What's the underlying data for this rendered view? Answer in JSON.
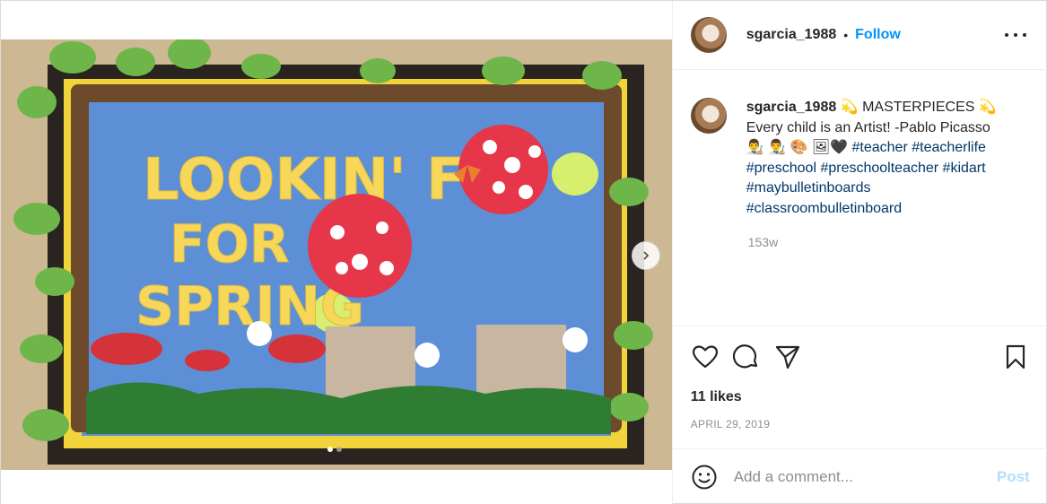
{
  "post": {
    "username": "sgarcia_1988",
    "separator": "•",
    "follow_label": "Follow",
    "caption": {
      "username": "sgarcia_1988",
      "text_line1": " 💫 MASTERPIECES 💫",
      "text_line2": "Every child is an Artist! -Pablo Picasso",
      "emoji_line": "👨‍🎨 👨‍🎨 🎨 🖼🖤 ",
      "hashtags": [
        "#teacher",
        "#teacherlife",
        "#preschool",
        "#preschoolteacher",
        "#kidart",
        "#maybulletinboards",
        "#classroombulletinboard"
      ],
      "time_ago": "153w"
    },
    "likes": "11 likes",
    "date": "APRIL 29, 2019",
    "comment": {
      "placeholder": "Add a comment...",
      "post_label": "Post"
    },
    "image": {
      "board_title_line1": "LOOKIN' FLY",
      "board_title_line2": "FOR",
      "board_title_line3": "SPRING"
    },
    "carousel": {
      "total": 2,
      "current": 1
    },
    "colors": {
      "accent": "#0095f6",
      "link": "#00376b",
      "muted": "#8e8e8e",
      "post_disabled": "#b2dffc"
    },
    "icons": [
      "more-options-icon",
      "heart-icon",
      "comment-icon",
      "share-icon",
      "bookmark-icon",
      "emoji-icon",
      "chevron-right-icon"
    ]
  }
}
